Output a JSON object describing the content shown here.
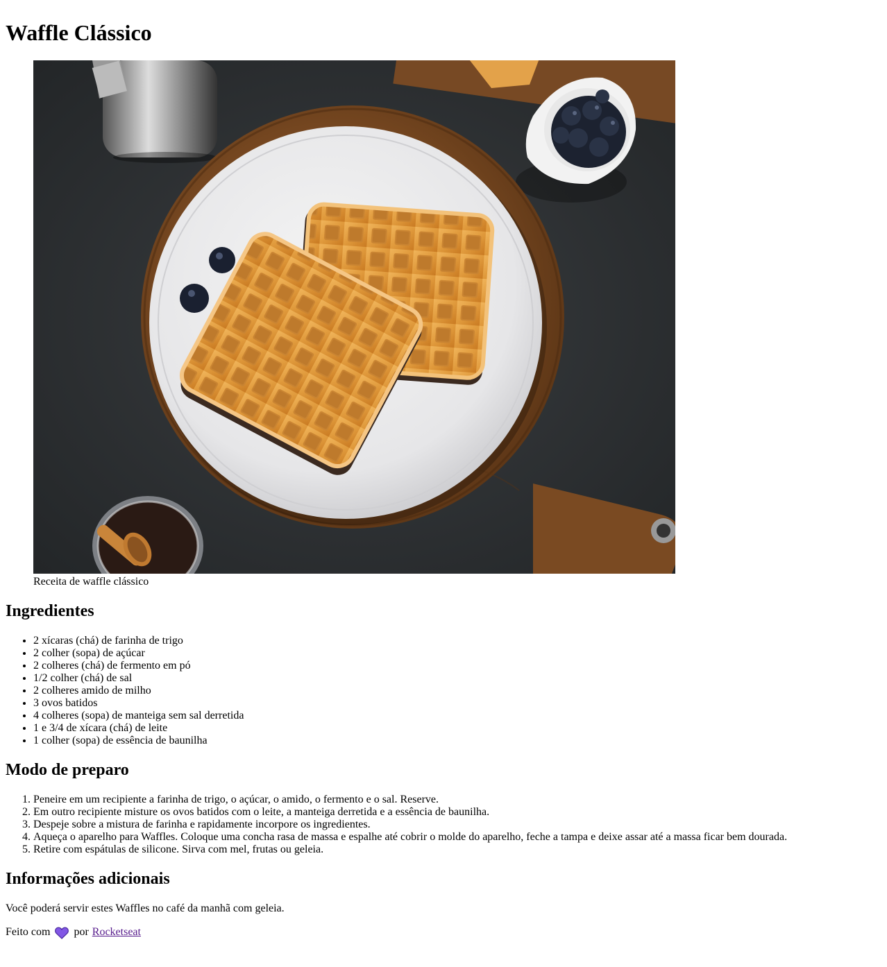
{
  "recipe": {
    "title": "Waffle Clássico",
    "image_alt": "Waffle clássico em prato branco sobre tábua de madeira com mirtilos",
    "caption": "Receita de waffle clássico"
  },
  "ingredients": {
    "heading": "Ingredientes",
    "items": [
      "2 xícaras (chá) de farinha de trigo",
      "2 colher (sopa) de açúcar",
      "2 colheres (chá) de fermento em pó",
      "1/2 colher (chá) de sal",
      "2 colheres amido de milho",
      "3 ovos batidos",
      "4 colheres (sopa) de manteiga sem sal derretida",
      "1 e 3/4 de xícara (chá) de leite",
      "1 colher (sopa) de essência de baunilha"
    ]
  },
  "preparation": {
    "heading": "Modo de preparo",
    "steps": [
      "Peneire em um recipiente a farinha de trigo, o açúcar, o amido, o fermento e o sal. Reserve.",
      "Em outro recipiente misture os ovos batidos com o leite, a manteiga derretida e a essência de baunilha.",
      "Despeje sobre a mistura de farinha e rapidamente incorpore os ingredientes.",
      "Aqueça o aparelho para Waffles. Coloque uma concha rasa de massa e espalhe até cobrir o molde do aparelho, feche a tampa e deixe assar até a massa ficar bem dourada.",
      "Retire com espátulas de silicone. Sirva com mel, frutas ou geleia."
    ]
  },
  "additional": {
    "heading": "Informações adicionais",
    "text": "Você poderá servir estes Waffles no café da manhã com geleia."
  },
  "footer": {
    "made_with": "Feito com",
    "heart_icon": "purple-heart-icon",
    "by": "por",
    "link_text": "Rocketseat"
  },
  "colors": {
    "heart": "#8257e5",
    "link": "#551a8b"
  }
}
